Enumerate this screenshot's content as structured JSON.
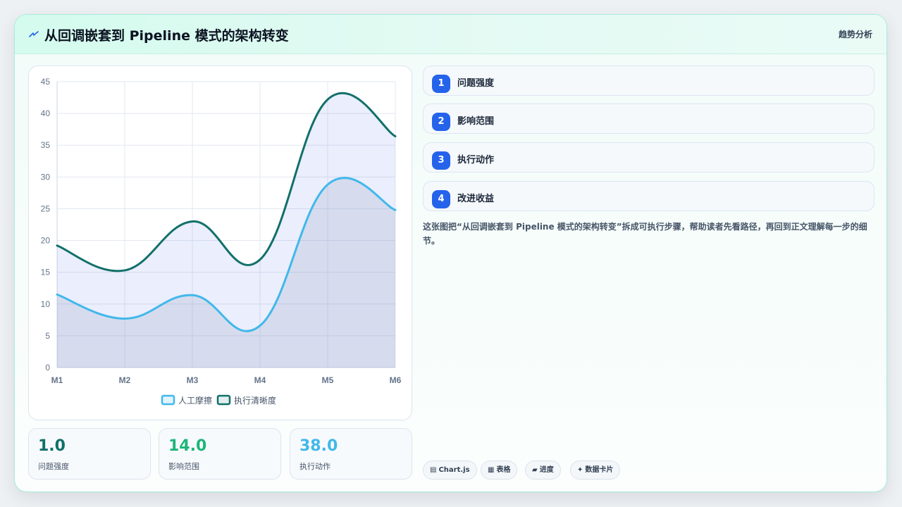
{
  "header": {
    "icon": "bolt-icon",
    "title": "从回调嵌套到 Pipeline 模式的架构转变",
    "tag": "趋势分析"
  },
  "chart_data": {
    "type": "line",
    "categories": [
      "M1",
      "M2",
      "M3",
      "M4",
      "M5",
      "M6"
    ],
    "series": [
      {
        "name": "人工摩擦",
        "values": [
          11.5,
          7.7,
          11.4,
          6.6,
          28.8,
          24.8
        ],
        "color": "#41b8ea"
      },
      {
        "name": "执行清晰度",
        "values": [
          19.2,
          15.3,
          23.0,
          17.0,
          42.2,
          36.4
        ],
        "color": "#12706a"
      }
    ],
    "ylim": [
      0,
      45
    ],
    "yticks": [
      0,
      5,
      10,
      15,
      20,
      25,
      30,
      35,
      40,
      45
    ],
    "grid": true,
    "legend": "bottom"
  },
  "stats": [
    {
      "value": "1.0",
      "label": "问题强度",
      "color": "#12706a"
    },
    {
      "value": "14.0",
      "label": "影响范围",
      "color": "#1fb57a"
    },
    {
      "value": "38.0",
      "label": "执行动作",
      "color": "#41b8ea"
    }
  ],
  "steps": [
    {
      "num": "1",
      "label": "问题强度"
    },
    {
      "num": "2",
      "label": "影响范围"
    },
    {
      "num": "3",
      "label": "执行动作"
    },
    {
      "num": "4",
      "label": "改进收益"
    }
  ],
  "description": "这张图把“从回调嵌套到 Pipeline 模式的架构转变”拆成可执行步骤，帮助读者先看路径，再回到正文理解每一步的细节。",
  "pills": [
    {
      "icon": "▤",
      "label": "Chart.js"
    },
    {
      "icon": "▦",
      "label": "表格"
    },
    {
      "icon": "▰",
      "label": "进度"
    },
    {
      "icon": "✦",
      "label": "数据卡片"
    }
  ]
}
